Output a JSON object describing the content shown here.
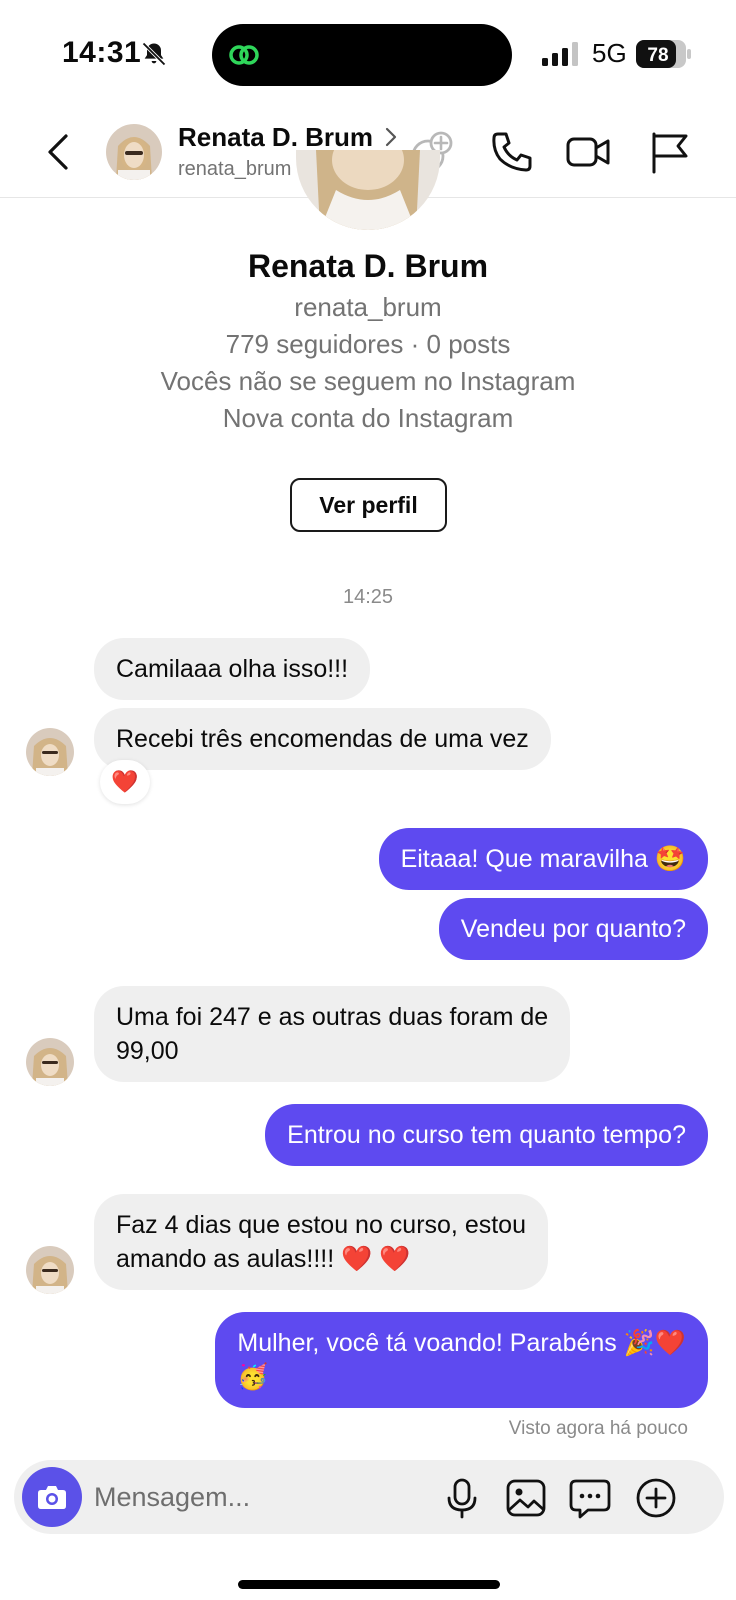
{
  "status_bar": {
    "time": "14:31",
    "network": "5G",
    "battery": "78"
  },
  "header": {
    "name": "Renata D. Brum",
    "username": "renata_brum"
  },
  "profile": {
    "name": "Renata D. Brum",
    "username": "renata_brum",
    "stats": "779 seguidores · 0 posts",
    "follow_note": "Vocês não se seguem no Instagram",
    "account_note": "Nova conta do Instagram",
    "view_profile_label": "Ver perfil"
  },
  "timestamp": "14:25",
  "messages": [
    {
      "from": "them",
      "text": "Camilaaa olha isso!!!"
    },
    {
      "from": "them",
      "text": "Recebi três encomendas de uma vez",
      "reaction": "❤️"
    },
    {
      "from": "me",
      "text": "Eitaaa! Que maravilha 🤩"
    },
    {
      "from": "me",
      "text": "Vendeu por quanto?"
    },
    {
      "from": "them",
      "text": "Uma foi 247 e as outras duas foram de\n99,00"
    },
    {
      "from": "me",
      "text": "Entrou no curso tem quanto tempo?"
    },
    {
      "from": "them",
      "text": "Faz 4 dias que estou no curso, estou\namando as aulas!!!! ❤️ ❤️"
    },
    {
      "from": "me",
      "text": "Mulher, você tá voando! Parabéns 🎉❤️\n🥳"
    }
  ],
  "seen": "Visto agora há pouco",
  "composer": {
    "placeholder": "Mensagem..."
  },
  "colors": {
    "accent": "#5e4af0",
    "incoming_bubble": "#efefef",
    "camera_button": "#5b51e8"
  },
  "icons": [
    "bell-off-icon",
    "threads-icon",
    "signal-icon",
    "battery-icon",
    "back-icon",
    "chevron-right-icon",
    "add-user-icon",
    "phone-icon",
    "video-icon",
    "flag-icon",
    "camera-icon",
    "microphone-icon",
    "image-icon",
    "sticker-icon",
    "plus-icon"
  ]
}
